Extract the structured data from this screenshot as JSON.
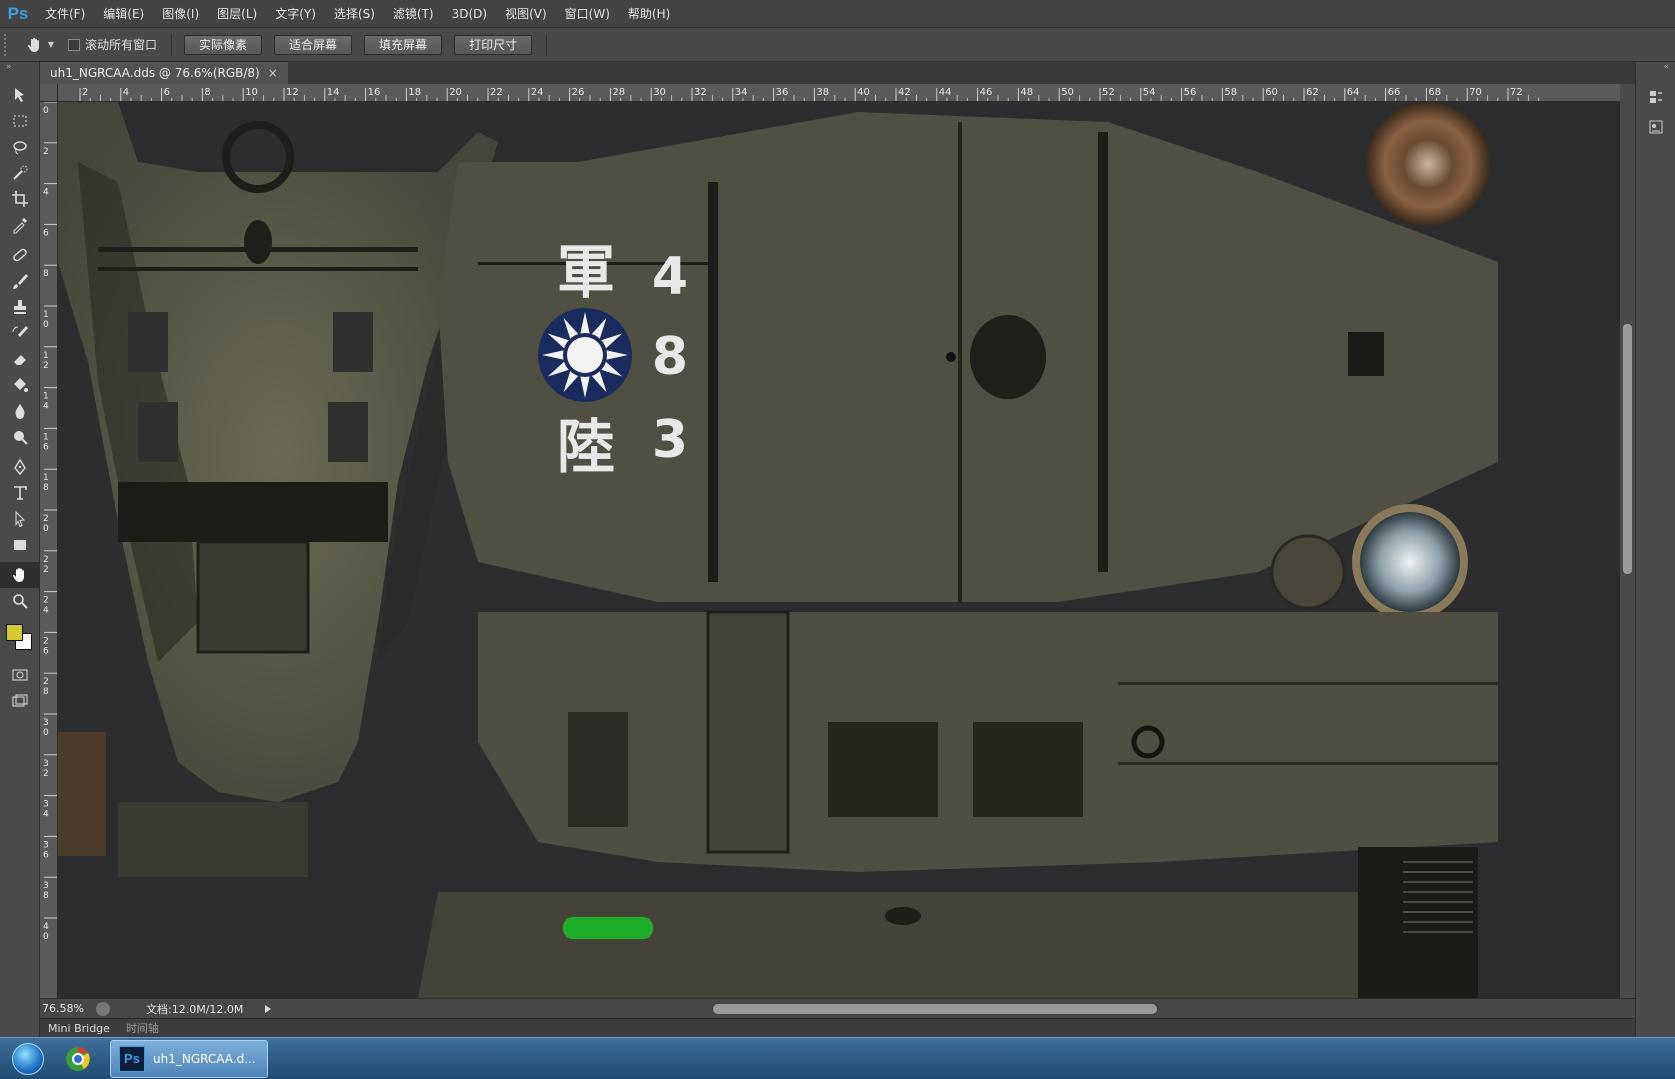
{
  "app": {
    "logo": "Ps",
    "accent": "#3d9fe0"
  },
  "menu": {
    "items": [
      "文件(F)",
      "编辑(E)",
      "图像(I)",
      "图层(L)",
      "文字(Y)",
      "选择(S)",
      "滤镜(T)",
      "3D(D)",
      "视图(V)",
      "窗口(W)",
      "帮助(H)"
    ]
  },
  "options": {
    "scroll_all_label": "滚动所有窗口",
    "buttons": [
      "实际像素",
      "适合屏幕",
      "填充屏幕",
      "打印尺寸"
    ]
  },
  "document": {
    "tab_title": "uh1_NGRCAA.dds @ 76.6%(RGB/8)",
    "close_glyph": "×"
  },
  "ruler": {
    "h_ticks": [
      "2",
      "4",
      "6",
      "8",
      "10",
      "12",
      "14",
      "16",
      "18",
      "20",
      "22",
      "24",
      "26",
      "28",
      "30",
      "32",
      "34",
      "36",
      "38",
      "40",
      "42",
      "44",
      "46",
      "48",
      "50",
      "52",
      "54",
      "56",
      "58",
      "60",
      "62",
      "64",
      "66",
      "68",
      "70",
      "72"
    ],
    "v_ticks": [
      "0",
      "2",
      "4",
      "6",
      "8",
      "10",
      "12",
      "14",
      "16",
      "18",
      "20",
      "22",
      "24",
      "26",
      "28",
      "30",
      "32",
      "34",
      "36",
      "38",
      "40"
    ]
  },
  "texture": {
    "chinese_chars": [
      "軍",
      "陸"
    ],
    "numbers": [
      "4",
      "8",
      "3"
    ],
    "emblem": "sun-emblem"
  },
  "tools": [
    {
      "name": "move-tool",
      "icon": "move-icon"
    },
    {
      "name": "marquee-tool",
      "icon": "marquee-icon"
    },
    {
      "name": "lasso-tool",
      "icon": "lasso-icon"
    },
    {
      "name": "quick-select-tool",
      "icon": "quick-select-icon"
    },
    {
      "name": "crop-tool",
      "icon": "crop-icon"
    },
    {
      "name": "eyedropper-tool",
      "icon": "eyedropper-icon"
    },
    {
      "name": "healing-tool",
      "icon": "healing-icon"
    },
    {
      "name": "brush-tool",
      "icon": "brush-icon"
    },
    {
      "name": "stamp-tool",
      "icon": "stamp-icon"
    },
    {
      "name": "history-brush-tool",
      "icon": "history-brush-icon"
    },
    {
      "name": "eraser-tool",
      "icon": "eraser-icon"
    },
    {
      "name": "bucket-tool",
      "icon": "bucket-icon"
    },
    {
      "name": "blur-tool",
      "icon": "blur-icon"
    },
    {
      "name": "dodge-tool",
      "icon": "dodge-icon"
    },
    {
      "name": "pen-tool",
      "icon": "pen-icon"
    },
    {
      "name": "type-tool",
      "icon": "type-icon"
    },
    {
      "name": "path-select-tool",
      "icon": "path-select-icon"
    },
    {
      "name": "shape-tool",
      "icon": "shape-icon"
    },
    {
      "name": "hand-tool",
      "icon": "hand-icon"
    },
    {
      "name": "zoom-tool",
      "icon": "zoom-icon"
    }
  ],
  "colors": {
    "foreground": "#d6cb2d",
    "background": "#ffffff"
  },
  "status": {
    "zoom": "76.58%",
    "doc_info": "文档:12.0M/12.0M"
  },
  "bottom_panel": {
    "tabs": [
      "Mini Bridge",
      "时间轴"
    ]
  },
  "taskbar": {
    "ps_label": "uh1_NGRCAA.d..."
  }
}
